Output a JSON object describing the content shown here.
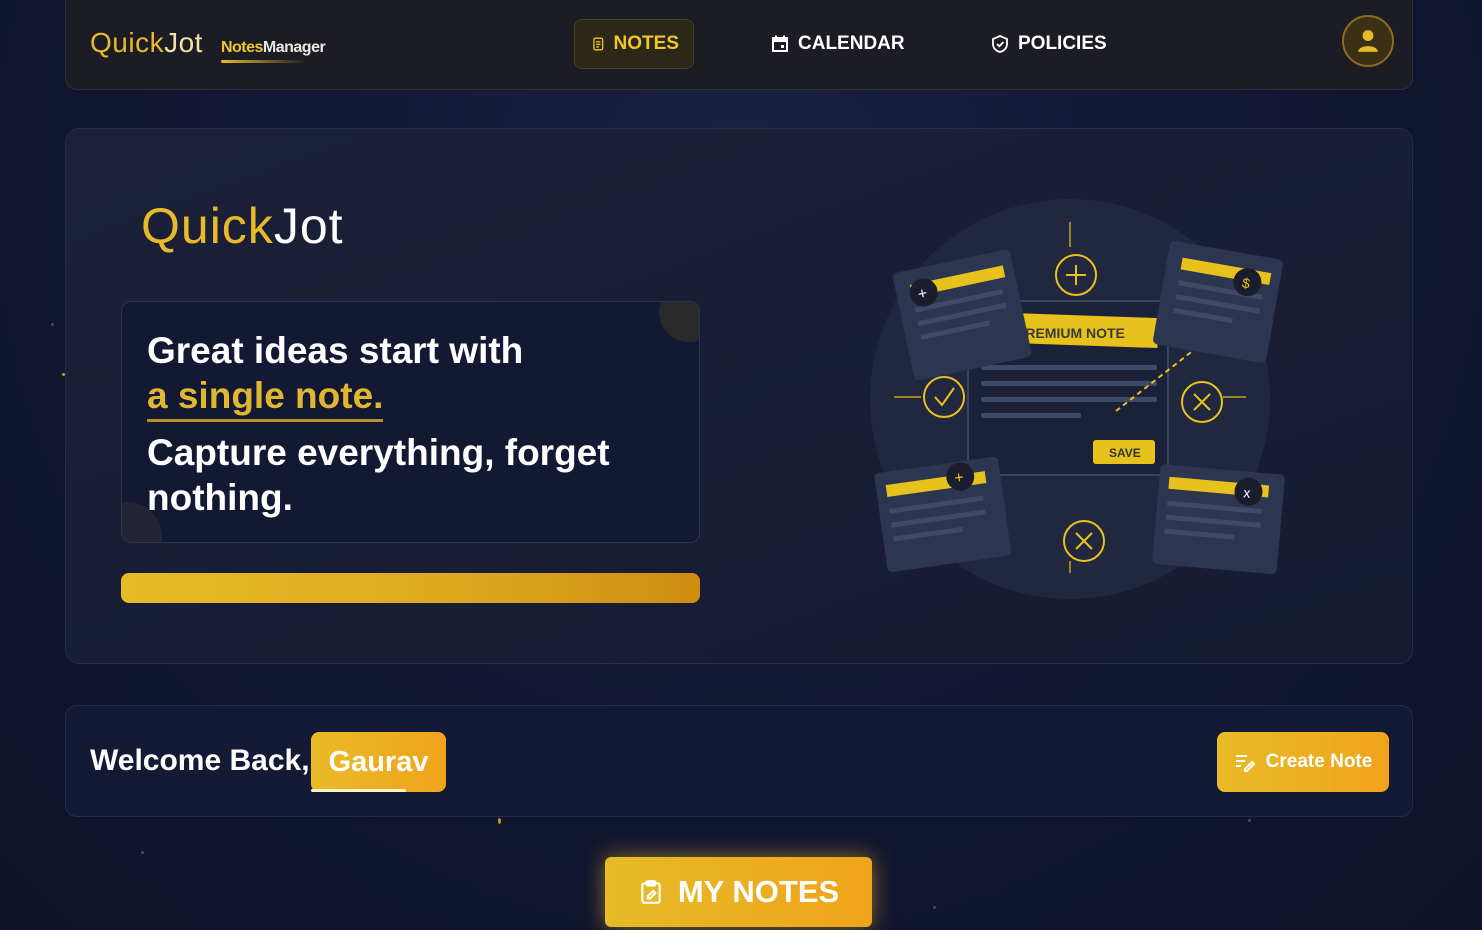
{
  "navbar": {
    "brand_quick": "Quick",
    "brand_jot": "Jot",
    "brand_sub_a": "Notes",
    "brand_sub_b": "Manager",
    "nav_notes": "NOTES",
    "nav_calendar": "CALENDAR",
    "nav_policies": "POLICIES"
  },
  "hero": {
    "logo_quick": "Quick",
    "logo_jot": "Jot",
    "quote_line1": "Great ideas start with",
    "quote_line2": "a single note.",
    "quote_line3": "Capture everything, forget nothing.",
    "illustration": {
      "premium_label": "PREMIUM NOTE",
      "save_label": "SAVE"
    }
  },
  "welcome": {
    "greeting": "Welcome Back,",
    "user_name": "Gaurav",
    "create_label": "Create Note"
  },
  "my_notes_label": "MY NOTES",
  "colors": {
    "accent": "#e8b928",
    "accent_orange": "#f0a31a",
    "background": "#121733",
    "panel": "#1c1c24"
  },
  "icons": [
    "notes-icon",
    "calendar-icon",
    "shield-check-icon",
    "user-icon",
    "edit-list-icon",
    "clipboard-edit-icon"
  ]
}
